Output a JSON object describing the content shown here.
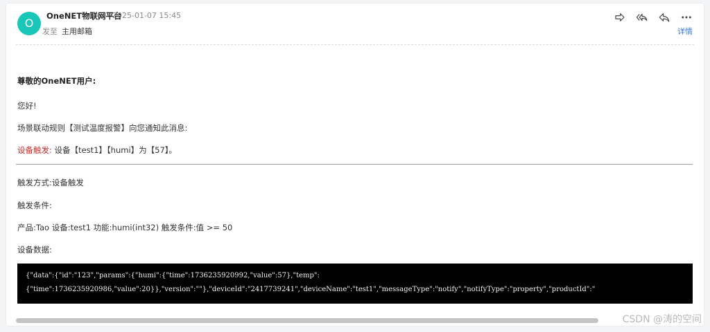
{
  "header": {
    "avatar_letter": "O",
    "sender": "OneNET物联网平台",
    "date": "2025-01-07 15:45",
    "to_label": "发至",
    "to_value": "主用邮箱",
    "details_label": "详情",
    "icons": [
      "forward-icon",
      "reply-all-icon",
      "reply-icon",
      "more-icon"
    ]
  },
  "body": {
    "greeting_title": "尊敬的OneNET用户:",
    "hello": "您好!",
    "notice": "场景联动规则【测试温度报警】向您通知此消息:",
    "trigger_label": "设备触发:",
    "trigger_text": "设备【test1】【humi】为【57】。",
    "method": "触发方式:设备触发",
    "condition": "触发条件:",
    "product_line": "产品:Tao 设备:test1 功能:humi(int32) 触发条件:值 >= 50",
    "device_data_label": "设备数据:",
    "code_line1": "{\"data\":{\"id\":\"123\",\"params\":{\"humi\":{\"time\":1736235920992,\"value\":57},\"temp\":",
    "code_line2": "{\"time\":1736235920986,\"value\":20}},\"version\":\"\"},\"deviceId\":\"2417739241\",\"deviceName\":\"test1\",\"messageType\":\"notify\",\"notifyType\":\"property\",\"productId\":\""
  },
  "watermark": "CSDN @涛的空间",
  "colors": {
    "accent": "#3a7bd5",
    "avatar": "#19c7b8",
    "trigger": "#d42b2b"
  }
}
